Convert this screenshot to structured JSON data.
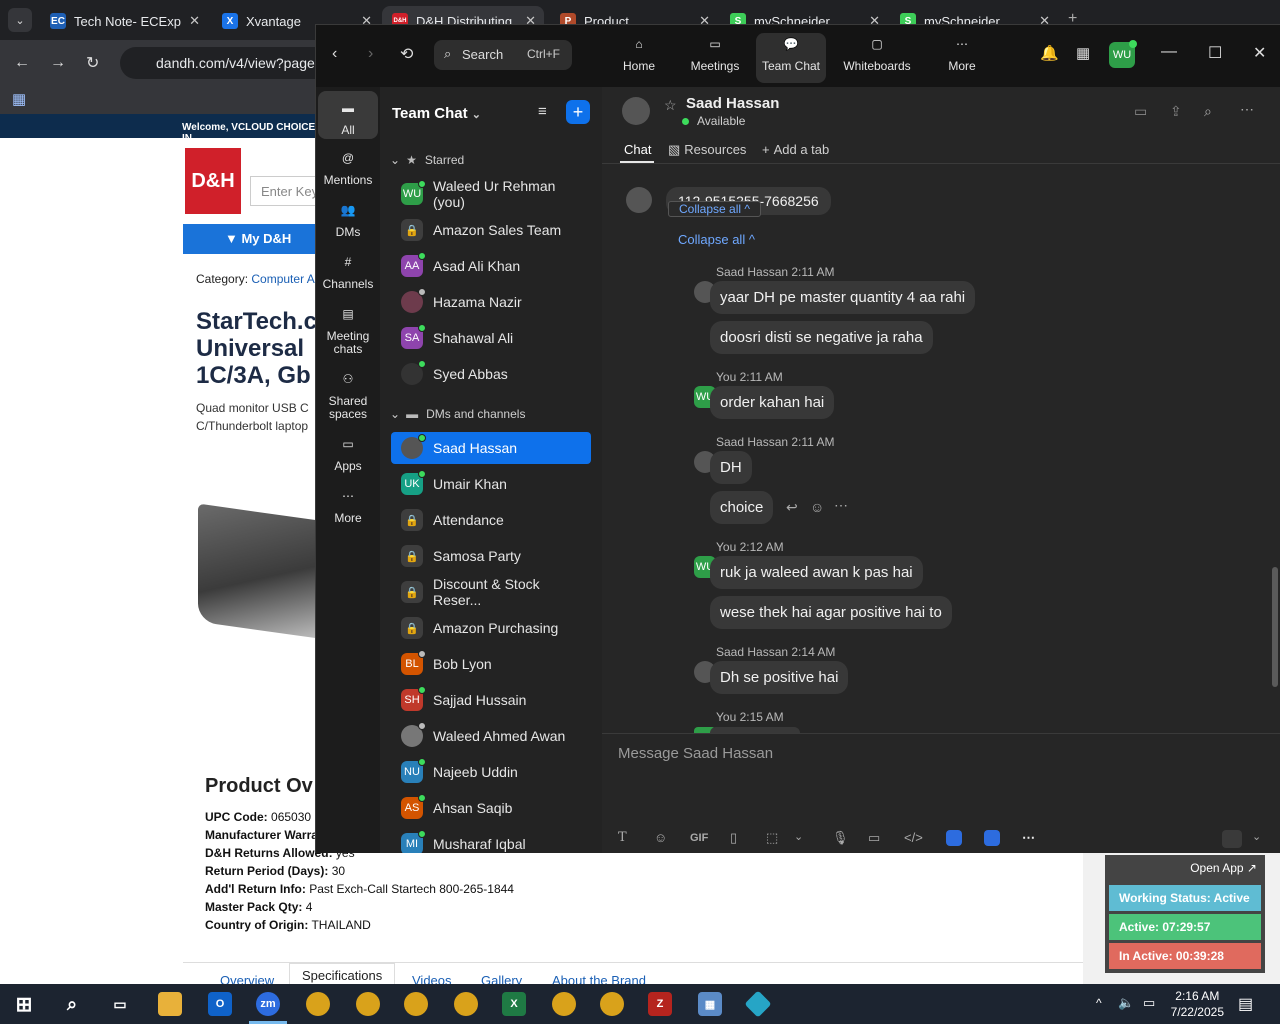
{
  "browser": {
    "tabs": [
      {
        "title": "Tech Note- ECExp",
        "icon": "EC",
        "color": "#1e5fb4"
      },
      {
        "title": "Xvantage",
        "icon": "X",
        "color": "#1a73e8"
      },
      {
        "title": "D&H Distributing",
        "icon": "D&H",
        "color": "#d0202a"
      },
      {
        "title": "Product",
        "icon": "P",
        "color": "#b04a2a"
      },
      {
        "title": "mySchneider",
        "icon": "S",
        "color": "#3dcd58"
      },
      {
        "title": "mySchneider",
        "icon": "S",
        "color": "#3dcd58"
      }
    ],
    "url": "dandh.com/v4/view?page"
  },
  "webpage": {
    "welcome": "Welcome, VCLOUD CHOICE IN",
    "logo": "D&H",
    "search_placeholder": "Enter Key",
    "mydh_button": "▼ My D&H",
    "category_label": "Category:",
    "category_value": "Computer Acc",
    "title_lines": [
      "StarTech.c",
      "Universal",
      "1C/3A, Gb"
    ],
    "desc_lines": [
      "Quad monitor USB C",
      "C/Thunderbolt laptop"
    ],
    "overview_heading": "Product Ov",
    "specs": [
      {
        "label": "UPC Code:",
        "value": "065030"
      },
      {
        "label": "Manufacturer Warra",
        "value": ""
      },
      {
        "label": "D&H Returns Allowed:",
        "value": "yes"
      },
      {
        "label": "Return Period (Days):",
        "value": "30"
      },
      {
        "label": "Add'l Return Info:",
        "value": "Past Exch-Call Startech 800-265-1844"
      },
      {
        "label": "Master Pack Qty:",
        "value": "4"
      },
      {
        "label": "Country of Origin:",
        "value": "THAILAND"
      }
    ],
    "tabs": [
      "Overview",
      "Specifications",
      "Videos",
      "Gallery",
      "About the Brand"
    ]
  },
  "widget": {
    "open_app": "Open App ↗",
    "working": "Working Status: Active",
    "active": "Active: 07:29:57",
    "inactive": "In Active: 00:39:28",
    "colors": {
      "working": "#5fbcd3",
      "active": "#4cc37a",
      "inactive": "#e06a5e"
    }
  },
  "taskbar": {
    "time": "2:16 AM",
    "date": "7/22/2025"
  },
  "zoom": {
    "search_label": "Search",
    "search_shortcut": "Ctrl+F",
    "nav": [
      "Home",
      "Meetings",
      "Team Chat",
      "Whiteboards",
      "More"
    ],
    "user_initials": "WU",
    "rail": [
      "All",
      "Mentions",
      "DMs",
      "Channels",
      "Meeting chats",
      "Shared spaces",
      "Apps",
      "More"
    ],
    "list_title": "Team Chat",
    "starred_label": "Starred",
    "starred": [
      {
        "name": "Waleed Ur Rehman (you)",
        "initials": "WU",
        "color": "#2e9e48",
        "status": "#3ddc5c"
      },
      {
        "name": "Amazon Sales Team",
        "initials": "",
        "color": "lock",
        "status": ""
      },
      {
        "name": "Asad Ali Khan",
        "initials": "AA",
        "color": "#8e44ad",
        "status": "#3ddc5c"
      },
      {
        "name": "Hazama Nazir",
        "initials": "",
        "color": "#6d3b4c",
        "status": "#bbbbbb"
      },
      {
        "name": "Shahawal Ali",
        "initials": "SA",
        "color": "#8e44ad",
        "status": "#3ddc5c"
      },
      {
        "name": "Syed Abbas",
        "initials": "",
        "color": "#333333",
        "status": "#3ddc5c"
      }
    ],
    "dms_label": "DMs and channels",
    "dms": [
      {
        "name": "Saad Hassan",
        "initials": "",
        "color": "#555555",
        "status": "#3ddc5c"
      },
      {
        "name": "Umair Khan",
        "initials": "UK",
        "color": "#16a085",
        "status": "#3ddc5c"
      },
      {
        "name": "Attendance",
        "initials": "",
        "color": "lock",
        "status": ""
      },
      {
        "name": "Samosa Party",
        "initials": "",
        "color": "lock",
        "status": ""
      },
      {
        "name": "Discount & Stock Reser...",
        "initials": "",
        "color": "lock",
        "status": ""
      },
      {
        "name": "Amazon Purchasing",
        "initials": "",
        "color": "lock",
        "status": ""
      },
      {
        "name": "Bob Lyon",
        "initials": "BL",
        "color": "#d35400",
        "status": "#bbbbbb"
      },
      {
        "name": "Sajjad Hussain",
        "initials": "SH",
        "color": "#c0392b",
        "status": "#3ddc5c"
      },
      {
        "name": "Waleed Ahmed Awan",
        "initials": "",
        "color": "#777777",
        "status": "#bbbbbb"
      },
      {
        "name": "Najeeb Uddin",
        "initials": "NU",
        "color": "#2980b9",
        "status": "#3ddc5c"
      },
      {
        "name": "Ahsan Saqib",
        "initials": "AS",
        "color": "#d35400",
        "status": "#3ddc5c"
      },
      {
        "name": "Musharaf Iqbal",
        "initials": "MI",
        "color": "#2980b9",
        "status": "#3ddc5c"
      }
    ],
    "chat": {
      "contact": "Saad Hassan",
      "status": "Available",
      "tabs": [
        "Chat",
        "Resources",
        "Add a tab"
      ],
      "phone_partial": "112-9515255-7668256",
      "collapse_overlay": "Collapse all ^",
      "collapse_all": "Collapse all ^",
      "messages": [
        {
          "sender": "Saad Hassan 2:11 AM",
          "mine": false,
          "texts": [
            "yaar DH pe master quantity 4 aa rahi",
            "doosri disti se negative ja raha"
          ]
        },
        {
          "sender": "You 2:11 AM",
          "mine": true,
          "texts": [
            "order kahan hai"
          ]
        },
        {
          "sender": "Saad Hassan 2:11 AM",
          "mine": false,
          "texts": [
            "DH",
            "choice"
          ]
        },
        {
          "sender": "You 2:12 AM",
          "mine": true,
          "texts": [
            "ruk ja waleed awan k pas hai",
            "wese thek hai agar positive hai to"
          ]
        },
        {
          "sender": "Saad Hassan 2:14 AM",
          "mine": false,
          "texts": [
            "Dh se positive hai"
          ]
        },
        {
          "sender": "You 2:15 AM",
          "mine": true,
          "texts": []
        }
      ],
      "composer_placeholder": "Message Saad Hassan",
      "gif_label": "GIF"
    }
  }
}
